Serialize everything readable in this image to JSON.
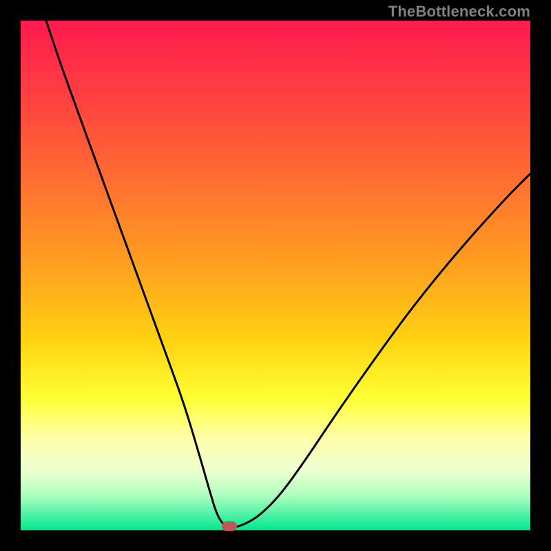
{
  "watermark": "TheBottleneck.com",
  "chart_data": {
    "type": "line",
    "title": "",
    "xlabel": "",
    "ylabel": "",
    "xlim": [
      0,
      100
    ],
    "ylim": [
      0,
      100
    ],
    "grid": false,
    "series": [
      {
        "name": "curve",
        "x": [
          5,
          8,
          12,
          16,
          20,
          24,
          28,
          32,
          35,
          37,
          38.5,
          40,
          41,
          42,
          44,
          47,
          51,
          56,
          62,
          69,
          77,
          86,
          95,
          100
        ],
        "y": [
          100,
          91,
          80,
          69,
          58,
          47,
          36,
          25,
          15,
          8,
          3,
          0.8,
          0.5,
          0.6,
          1.2,
          3,
          7,
          14,
          23,
          33,
          44,
          55,
          65,
          70
        ]
      }
    ],
    "marker": {
      "x": 41,
      "y": 0.8,
      "color": "#c05858"
    },
    "gradient_stops": [
      {
        "pos": 0,
        "color": "#ff1a4f"
      },
      {
        "pos": 15,
        "color": "#ff4040"
      },
      {
        "pos": 32,
        "color": "#ff7030"
      },
      {
        "pos": 48,
        "color": "#ffa020"
      },
      {
        "pos": 62,
        "color": "#ffd010"
      },
      {
        "pos": 74,
        "color": "#ffff33"
      },
      {
        "pos": 82,
        "color": "#ffffaa"
      },
      {
        "pos": 88,
        "color": "#f0ffd0"
      },
      {
        "pos": 93,
        "color": "#b0ffc0"
      },
      {
        "pos": 100,
        "color": "#00e890"
      }
    ]
  }
}
